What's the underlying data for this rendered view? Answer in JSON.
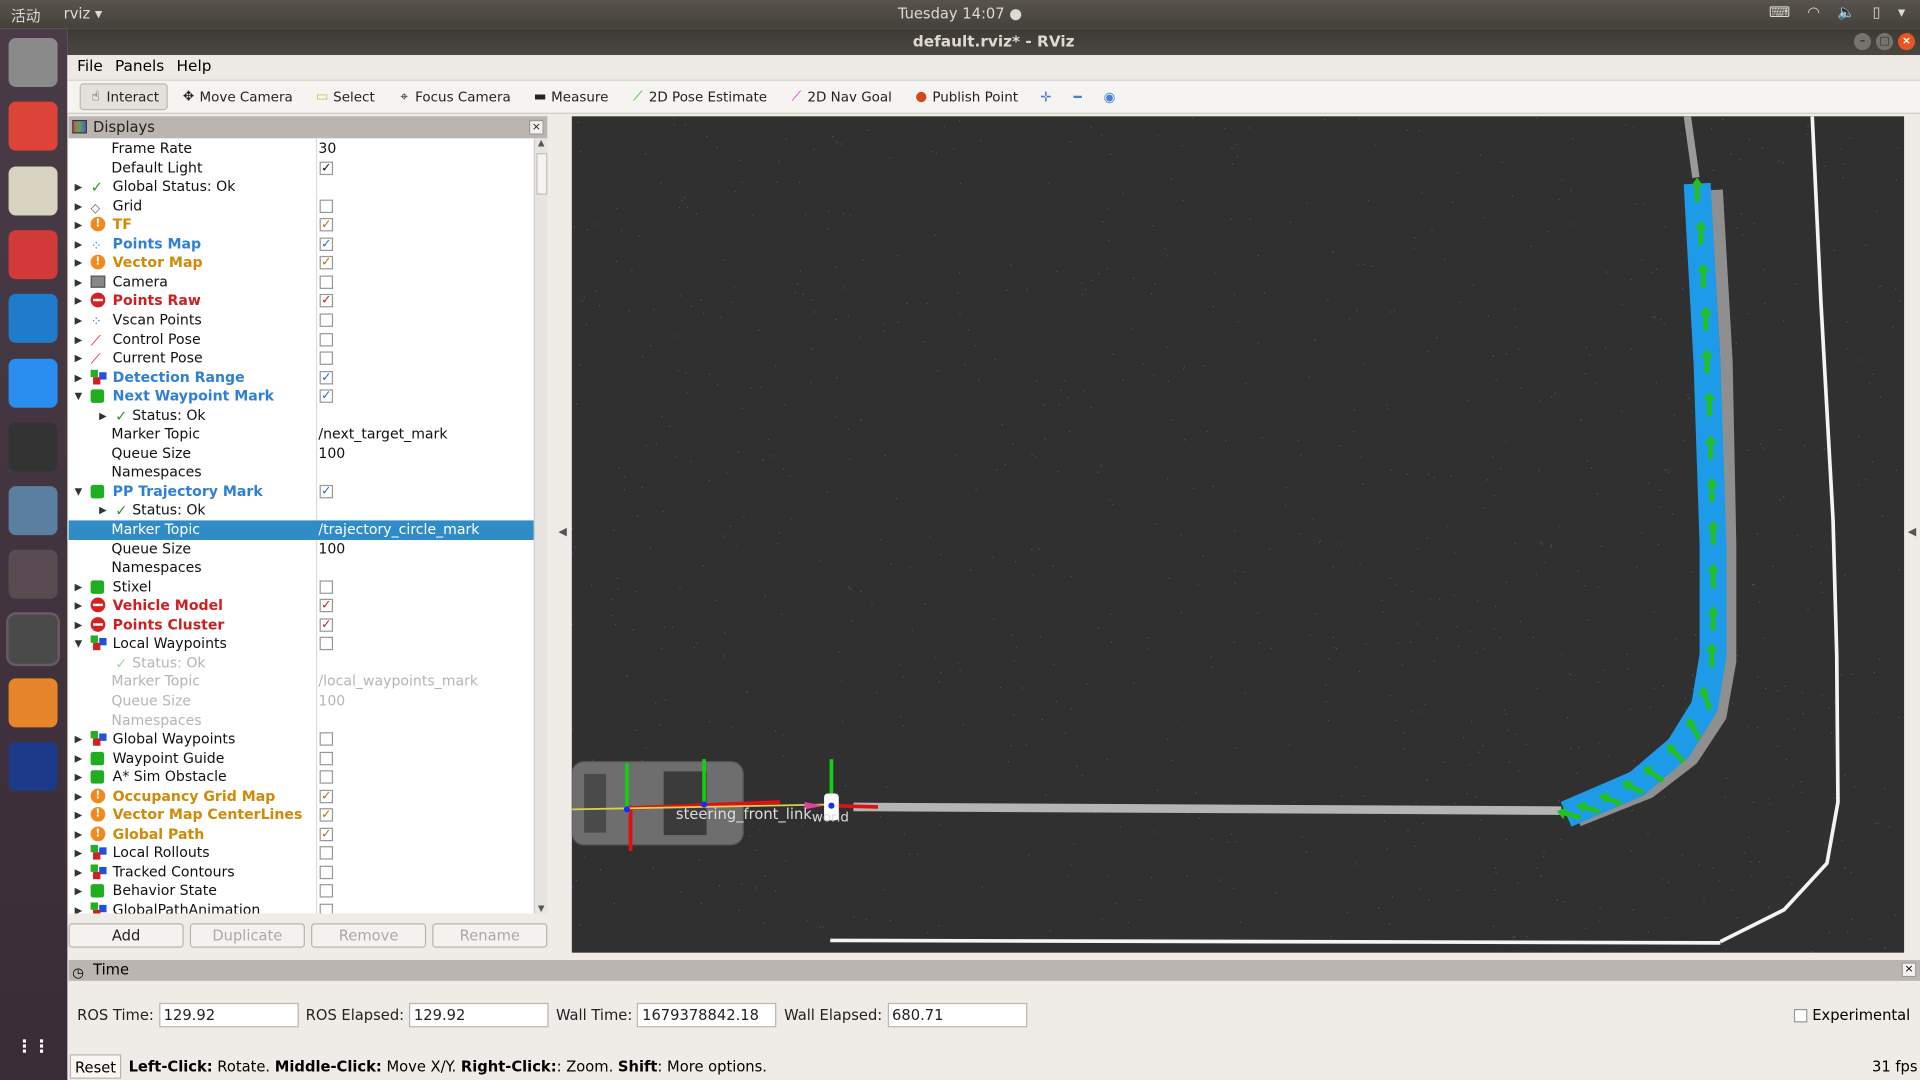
{
  "system_bar": {
    "activities": "活动",
    "app_name": "rviz",
    "clock": "Tuesday 14:07 ●"
  },
  "window": {
    "title": "default.rviz* - RViz"
  },
  "dock": [
    {
      "name": "files",
      "color": "#8a8a8a"
    },
    {
      "name": "chrome",
      "color": "#db4437"
    },
    {
      "name": "text-editor",
      "color": "#d8d2c0"
    },
    {
      "name": "terminal-red",
      "color": "#d23a3a"
    },
    {
      "name": "vscode",
      "color": "#1f7ccc"
    },
    {
      "name": "app-blue",
      "color": "#2a8ef0"
    },
    {
      "name": "terminal",
      "color": "#333"
    },
    {
      "name": "viewer",
      "color": "#5a7fa0"
    },
    {
      "name": "stop-app",
      "color": "#5a4a52"
    },
    {
      "name": "rviz",
      "color": "#4a4a4a"
    },
    {
      "name": "layers",
      "color": "#e7852b"
    },
    {
      "name": "autoware",
      "color": "#1d3a8a"
    }
  ],
  "menu": [
    "File",
    "Panels",
    "Help"
  ],
  "toolbar": [
    {
      "label": "Interact",
      "icon": "hand-icon",
      "active": true
    },
    {
      "label": "Move Camera",
      "icon": "move-icon"
    },
    {
      "label": "Select",
      "icon": "select-icon"
    },
    {
      "label": "Focus Camera",
      "icon": "focus-icon"
    },
    {
      "label": "Measure",
      "icon": "ruler-icon"
    },
    {
      "label": "2D Pose Estimate",
      "icon": "green-arrow-icon"
    },
    {
      "label": "2D Nav Goal",
      "icon": "magenta-arrow-icon"
    },
    {
      "label": "Publish Point",
      "icon": "pin-icon"
    }
  ],
  "displays": {
    "title": "Displays",
    "rows": [
      {
        "label": "Frame Rate",
        "value": "30",
        "level": 1
      },
      {
        "label": "Default Light",
        "check": true,
        "level": 1
      },
      {
        "label": "Global Status: Ok",
        "icon": "check",
        "exp": "r",
        "level": 0
      },
      {
        "label": "Grid",
        "icon": "grid",
        "exp": "r",
        "check": false,
        "level": 0
      },
      {
        "label": "TF",
        "icon": "warn",
        "exp": "r",
        "check": true,
        "style": "warn",
        "level": 0
      },
      {
        "label": "Points Map",
        "icon": "points",
        "exp": "r",
        "check": true,
        "style": "info",
        "level": 0
      },
      {
        "label": "Vector Map",
        "icon": "warn",
        "exp": "r",
        "check": true,
        "style": "warn",
        "level": 0
      },
      {
        "label": "Camera",
        "icon": "camera",
        "exp": "r",
        "check": false,
        "level": 0
      },
      {
        "label": "Points Raw",
        "icon": "error",
        "exp": "r",
        "check": true,
        "style": "error",
        "level": 0
      },
      {
        "label": "Vscan Points",
        "icon": "points",
        "exp": "r",
        "check": false,
        "level": 0
      },
      {
        "label": "Control Pose",
        "icon": "pose",
        "exp": "r",
        "check": false,
        "level": 0
      },
      {
        "label": "Current Pose",
        "icon": "pose",
        "exp": "r",
        "check": false,
        "level": 0
      },
      {
        "label": "Detection Range",
        "icon": "cubes",
        "exp": "r",
        "check": true,
        "style": "info",
        "level": 0
      },
      {
        "label": "Next Waypoint Mark",
        "icon": "cube",
        "exp": "d",
        "check": true,
        "style": "info",
        "level": 0
      },
      {
        "label": "Status: Ok",
        "icon": "check",
        "exp": "r",
        "level": 2
      },
      {
        "label": "Marker Topic",
        "value": "/next_target_mark",
        "level": 1
      },
      {
        "label": "Queue Size",
        "value": "100",
        "level": 1
      },
      {
        "label": "Namespaces",
        "level": 1
      },
      {
        "label": "PP Trajectory Mark",
        "icon": "cube",
        "exp": "d",
        "check": true,
        "style": "info",
        "level": 0
      },
      {
        "label": "Status: Ok",
        "icon": "check",
        "exp": "r",
        "level": 2
      },
      {
        "label": "Marker Topic",
        "value": "/trajectory_circle_mark",
        "level": 1,
        "selected": true
      },
      {
        "label": "Queue Size",
        "value": "100",
        "level": 1
      },
      {
        "label": "Namespaces",
        "level": 1
      },
      {
        "label": "Stixel",
        "icon": "cube",
        "exp": "r",
        "check": false,
        "level": 0
      },
      {
        "label": "Vehicle Model",
        "icon": "error",
        "exp": "r",
        "check": true,
        "style": "error",
        "level": 0
      },
      {
        "label": "Points Cluster",
        "icon": "error",
        "exp": "r",
        "check": true,
        "style": "error",
        "level": 0
      },
      {
        "label": "Local Waypoints",
        "icon": "cubes",
        "exp": "d",
        "check": false,
        "level": 0
      },
      {
        "label": "Status: Ok",
        "icon": "check",
        "level": 2,
        "style": "disabled"
      },
      {
        "label": "Marker Topic",
        "value": "/local_waypoints_mark",
        "level": 1,
        "style": "disabled"
      },
      {
        "label": "Queue Size",
        "value": "100",
        "level": 1,
        "style": "disabled"
      },
      {
        "label": "Namespaces",
        "level": 1,
        "style": "disabled"
      },
      {
        "label": "Global Waypoints",
        "icon": "cubes",
        "exp": "r",
        "check": false,
        "level": 0
      },
      {
        "label": "Waypoint Guide",
        "icon": "cube",
        "exp": "r",
        "check": false,
        "level": 0
      },
      {
        "label": "A* Sim Obstacle",
        "icon": "cube",
        "exp": "r",
        "check": false,
        "level": 0
      },
      {
        "label": "Occupancy Grid Map",
        "icon": "warn",
        "exp": "r",
        "check": true,
        "style": "warn",
        "level": 0
      },
      {
        "label": "Vector Map CenterLines",
        "icon": "warn",
        "exp": "r",
        "check": true,
        "style": "warn",
        "level": 0
      },
      {
        "label": "Global Path",
        "icon": "warn",
        "exp": "r",
        "check": true,
        "style": "warn",
        "level": 0
      },
      {
        "label": "Local Rollouts",
        "icon": "cubes",
        "exp": "r",
        "check": false,
        "level": 0
      },
      {
        "label": "Tracked Contours",
        "icon": "cubes",
        "exp": "r",
        "check": false,
        "level": 0
      },
      {
        "label": "Behavior State",
        "icon": "cube",
        "exp": "r",
        "check": false,
        "level": 0
      },
      {
        "label": "GlobalPathAnimation",
        "icon": "cubes",
        "exp": "r",
        "check": false,
        "level": 0
      }
    ],
    "buttons": {
      "add": "Add",
      "duplicate": "Duplicate",
      "remove": "Remove",
      "rename": "Rename"
    }
  },
  "viewer": {
    "labels": {
      "steering": "steering_front_link",
      "world": "world"
    }
  },
  "time": {
    "title": "Time",
    "ros_time_label": "ROS Time:",
    "ros_time": "129.92",
    "ros_elapsed_label": "ROS Elapsed:",
    "ros_elapsed": "129.92",
    "wall_time_label": "Wall Time:",
    "wall_time": "1679378842.18",
    "wall_elapsed_label": "Wall Elapsed:",
    "wall_elapsed": "680.71",
    "experimental": "Experimental"
  },
  "status": {
    "reset": "Reset",
    "hint_parts": [
      [
        "Left-Click:",
        true
      ],
      [
        " Rotate. ",
        false
      ],
      [
        "Middle-Click:",
        true
      ],
      [
        " Move X/Y. ",
        false
      ],
      [
        "Right-Click:",
        true
      ],
      [
        ": Zoom. ",
        false
      ],
      [
        "Shift",
        true
      ],
      [
        ": More options.",
        false
      ]
    ],
    "fps": "31 fps"
  },
  "colors": {
    "selection": "#308cc6",
    "warn": "#d08a06",
    "info": "#2f7fd6",
    "error": "#cc2020",
    "trajectory": "#1e9be8",
    "arrows": "#22c022"
  }
}
